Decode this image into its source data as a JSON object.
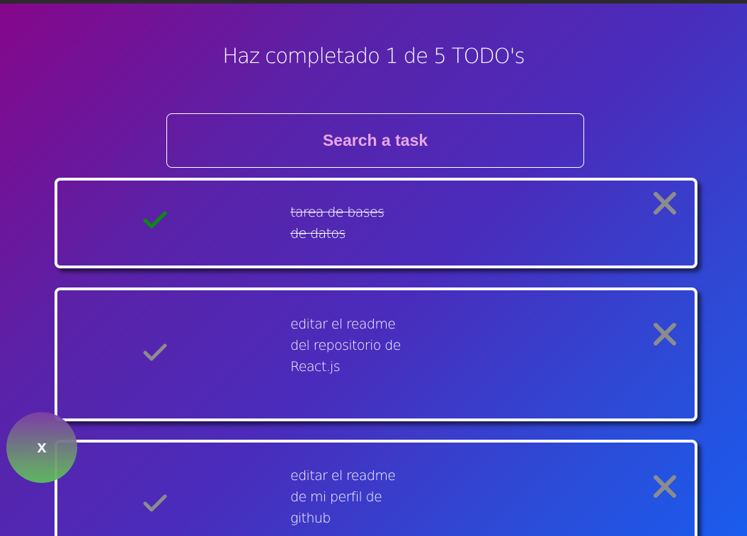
{
  "header": {
    "title": "Haz completado 1 de 5 TODO's"
  },
  "search": {
    "placeholder": "Search a task"
  },
  "todos": [
    {
      "text": "tarea de bases de datos",
      "completed": true,
      "check_icon": "check-icon",
      "delete_icon": "close-icon"
    },
    {
      "text": "editar el readme del repositorio de React.js",
      "completed": false,
      "check_icon": "check-icon",
      "delete_icon": "close-icon"
    },
    {
      "text": "editar el readme de mi perfil de github",
      "completed": false,
      "check_icon": "check-icon",
      "delete_icon": "close-icon"
    }
  ],
  "fab": {
    "label": "x",
    "icon": "close-icon"
  },
  "colors": {
    "check_completed": "#0a8a12",
    "check_pending": "#8c8c8c",
    "delete": "#8c8c8c",
    "placeholder": "#e9a6e6",
    "gradient_start": "#86068a",
    "gradient_end": "#1a5cee"
  }
}
